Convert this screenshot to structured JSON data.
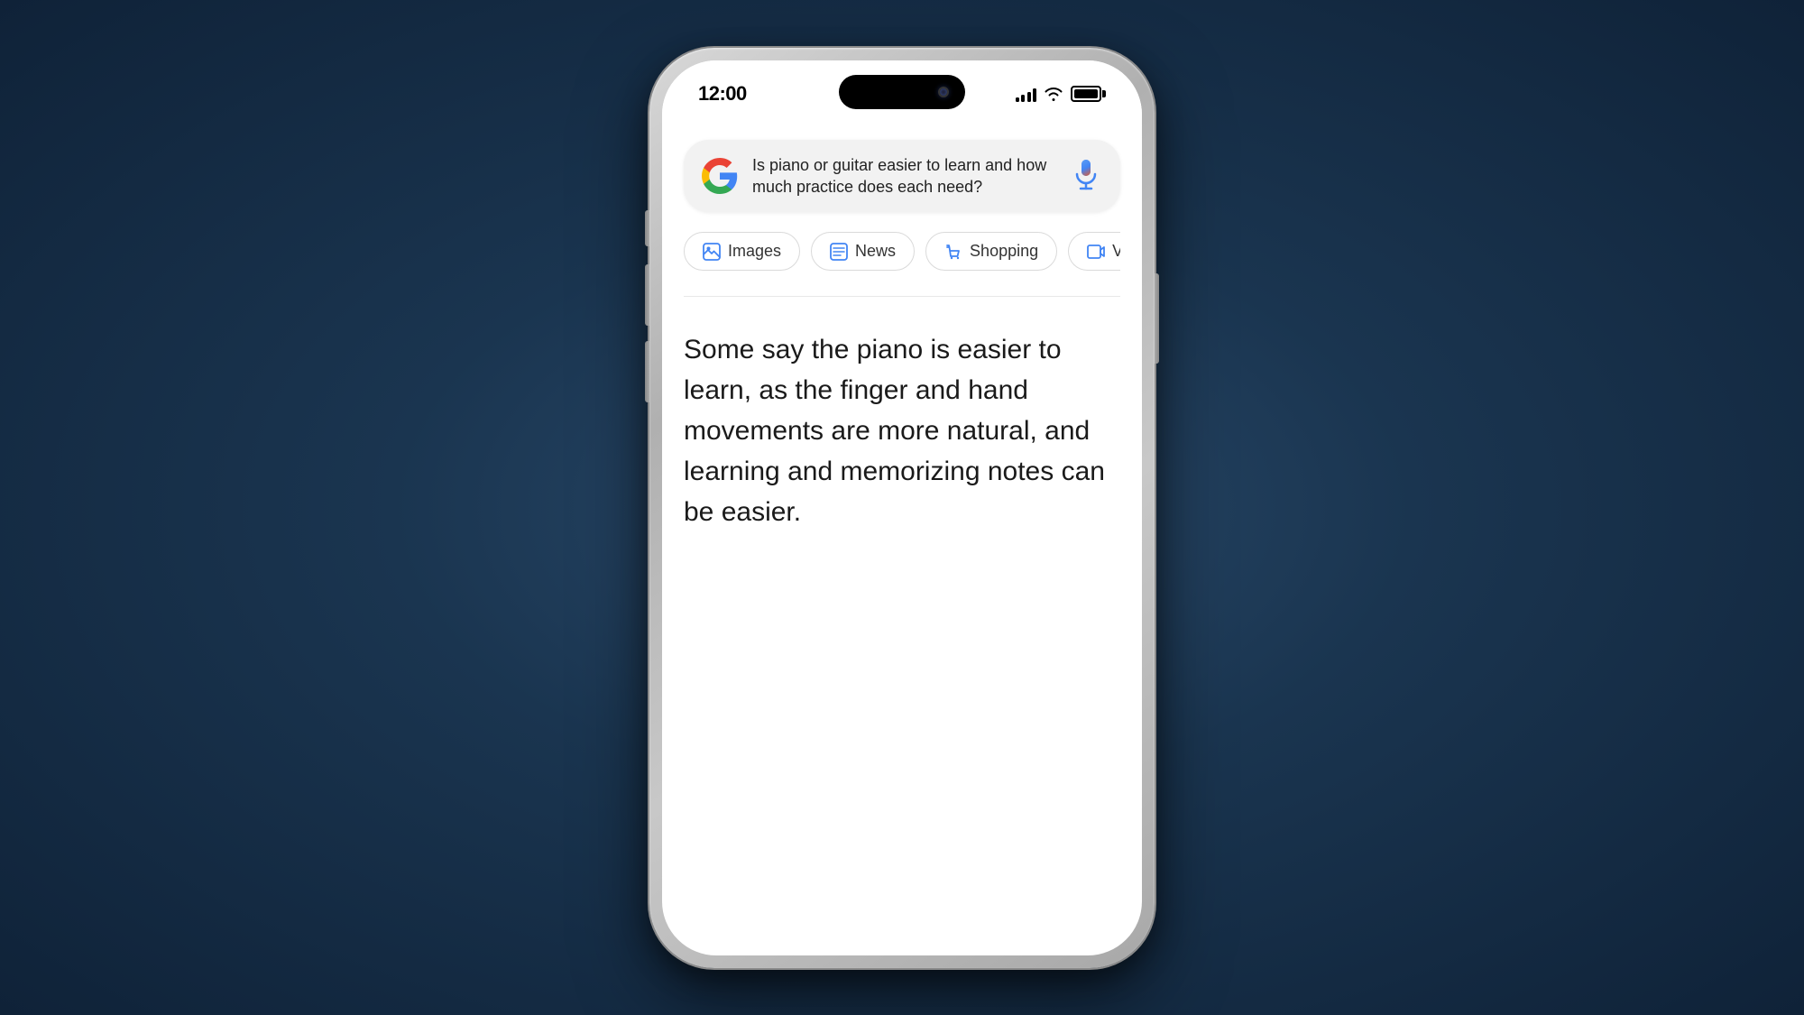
{
  "phone": {
    "status_bar": {
      "time": "12:00"
    },
    "search": {
      "query": "Is piano or guitar easier to learn and how much practice does each need?"
    },
    "chips": [
      {
        "id": "images",
        "label": "Images",
        "icon": "image-icon"
      },
      {
        "id": "news",
        "label": "News",
        "icon": "news-icon"
      },
      {
        "id": "shopping",
        "label": "Shopping",
        "icon": "shopping-icon"
      },
      {
        "id": "videos",
        "label": "Vide...",
        "icon": "video-icon"
      }
    ],
    "content_text": "Some say the piano is easier to learn, as the finger and hand movements are more natural, and learning and memorizing notes can be easier.",
    "colors": {
      "accent_blue": "#4285f4",
      "google_red": "#ea4335",
      "google_yellow": "#fbbc05",
      "google_green": "#34a853"
    }
  }
}
